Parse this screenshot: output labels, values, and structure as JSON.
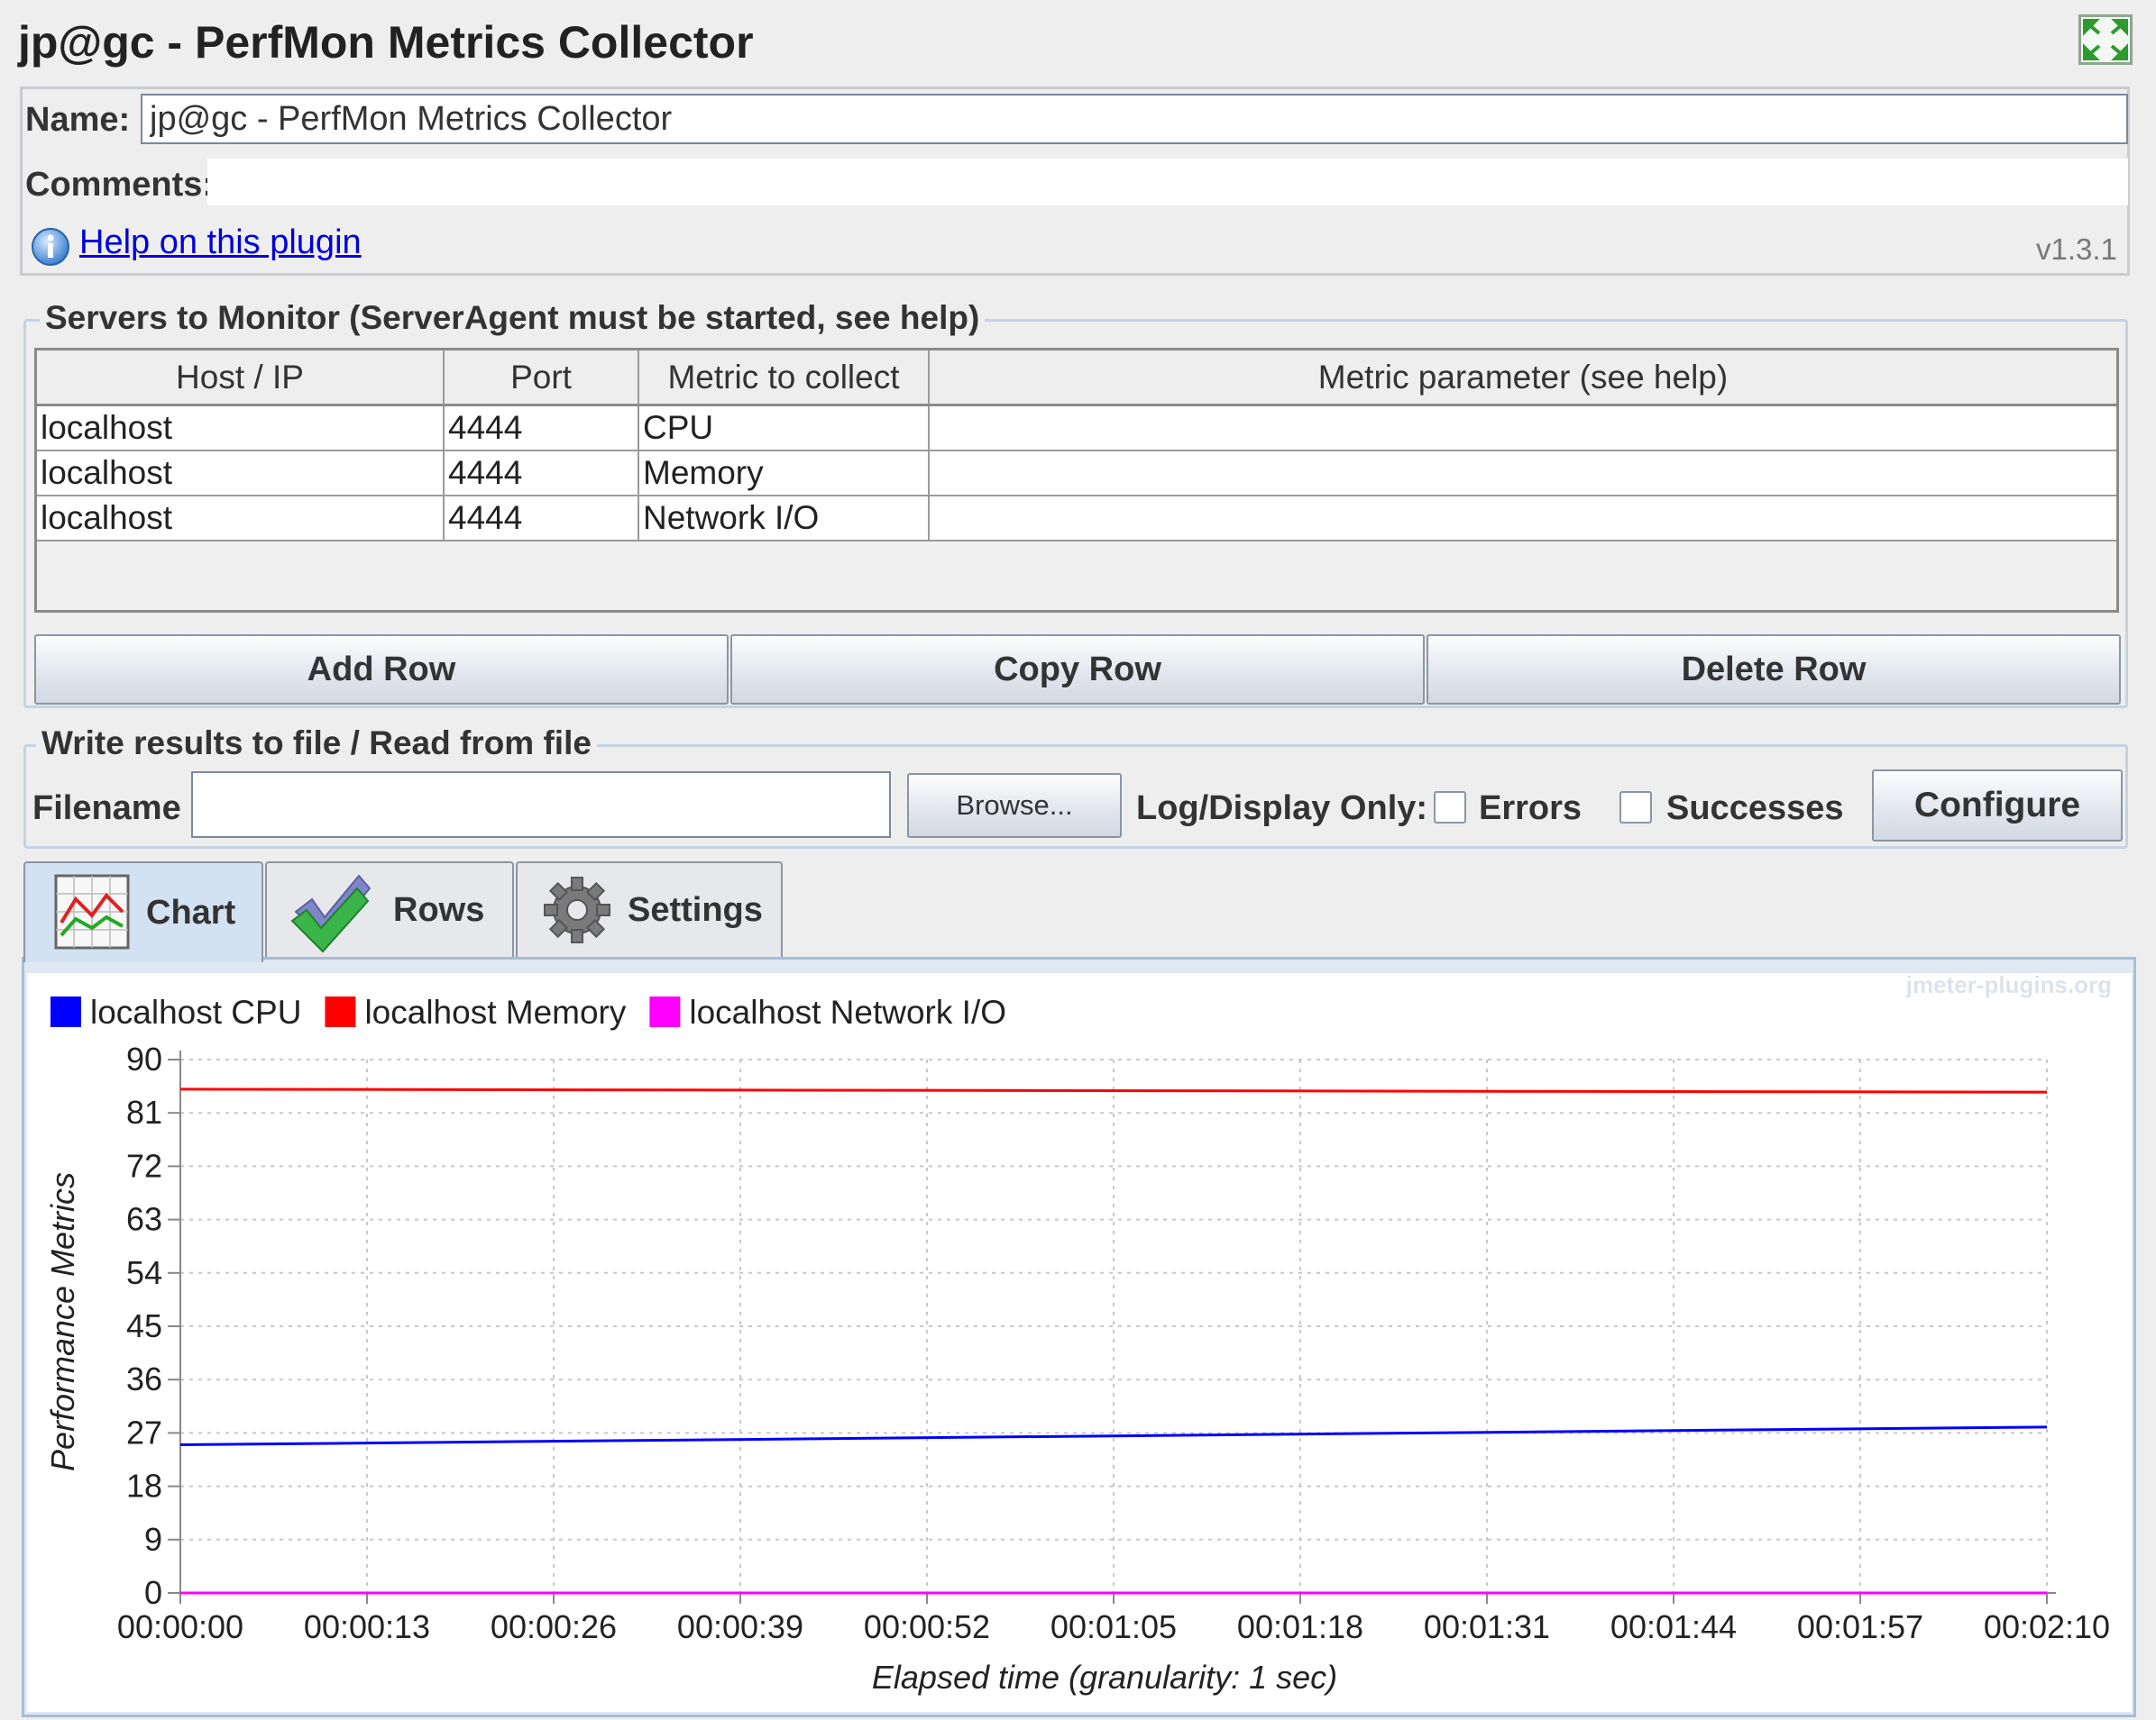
{
  "window": {
    "title": "jp@gc - PerfMon Metrics Collector"
  },
  "form": {
    "name_label": "Name:",
    "name_value": "jp@gc - PerfMon Metrics Collector",
    "comments_label": "Comments:",
    "comments_value": "",
    "help_link": "Help on this plugin",
    "version": "v1.3.1"
  },
  "servers": {
    "title": "Servers to Monitor (ServerAgent must be started, see help)",
    "columns": [
      "Host / IP",
      "Port",
      "Metric to collect",
      "Metric parameter (see help)"
    ],
    "rows": [
      {
        "host": "localhost",
        "port": "4444",
        "metric": "CPU",
        "param": ""
      },
      {
        "host": "localhost",
        "port": "4444",
        "metric": "Memory",
        "param": ""
      },
      {
        "host": "localhost",
        "port": "4444",
        "metric": "Network I/O",
        "param": ""
      }
    ],
    "buttons": {
      "add": "Add Row",
      "copy": "Copy Row",
      "delete": "Delete Row"
    }
  },
  "file": {
    "title": "Write results to file / Read from file",
    "filename_label": "Filename",
    "filename_value": "",
    "browse": "Browse...",
    "log_label": "Log/Display Only:",
    "errors_label": "Errors",
    "errors_checked": false,
    "successes_label": "Successes",
    "successes_checked": false,
    "configure": "Configure"
  },
  "tabs": [
    {
      "label": "Chart",
      "icon": "chart-icon",
      "active": true
    },
    {
      "label": "Rows",
      "icon": "checkmark-icon",
      "active": false
    },
    {
      "label": "Settings",
      "icon": "gear-icon",
      "active": false
    }
  ],
  "chart_data": {
    "type": "line",
    "watermark": "jmeter-plugins.org",
    "xlabel": "Elapsed time (granularity: 1 sec)",
    "ylabel": "Performance Metrics",
    "x_ticks": [
      "00:00:00",
      "00:00:13",
      "00:00:26",
      "00:00:39",
      "00:00:52",
      "00:01:05",
      "00:01:18",
      "00:01:31",
      "00:01:44",
      "00:01:57",
      "00:02:10"
    ],
    "y_ticks": [
      0,
      9,
      18,
      27,
      36,
      45,
      54,
      63,
      72,
      81,
      90
    ],
    "ylim": [
      0,
      90
    ],
    "grid": true,
    "legend_position": "top-left",
    "series": [
      {
        "name": "localhost CPU",
        "color": "#0000ff",
        "x_seconds": [
          0,
          130
        ],
        "values": [
          25,
          28
        ]
      },
      {
        "name": "localhost Memory",
        "color": "#ff0000",
        "x_seconds": [
          0,
          130
        ],
        "values": [
          85,
          84.5
        ]
      },
      {
        "name": "localhost Network I/O",
        "color": "#ff00ff",
        "x_seconds": [
          0,
          130
        ],
        "values": [
          0,
          0
        ]
      }
    ]
  }
}
